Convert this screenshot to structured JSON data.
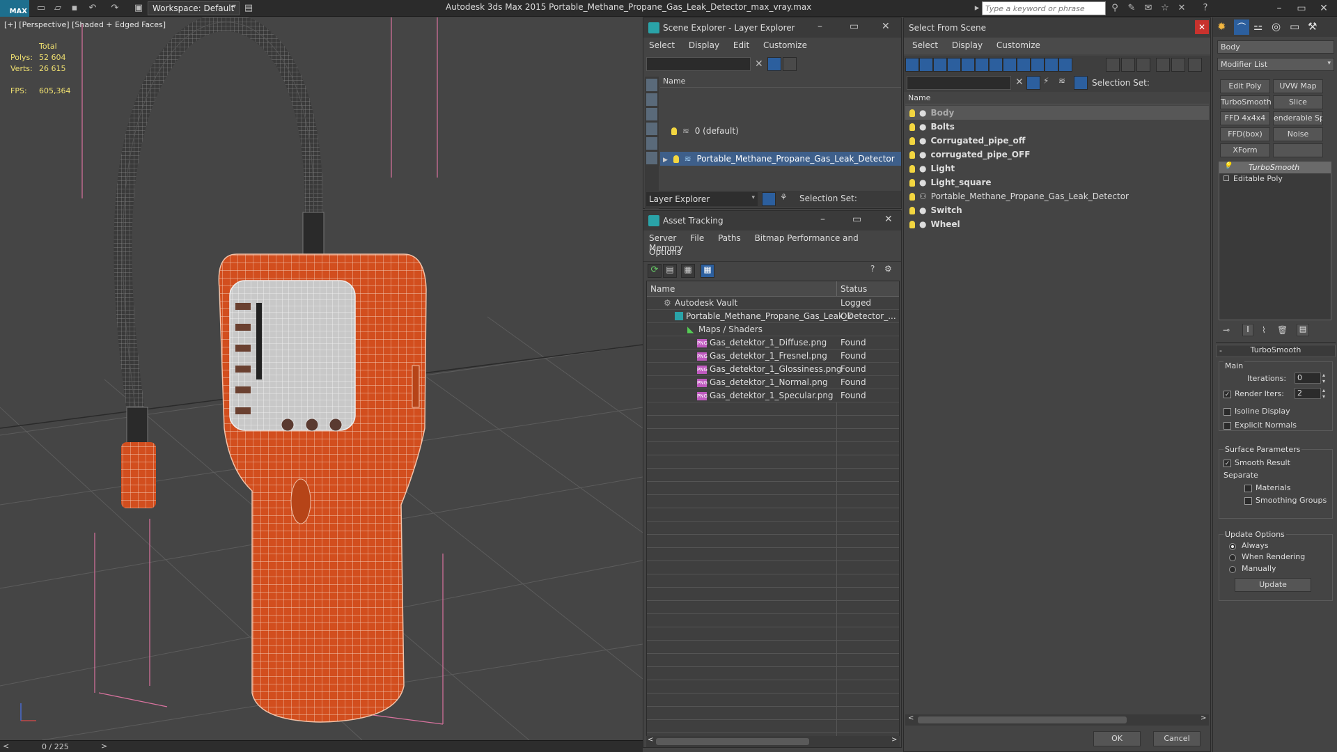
{
  "app": {
    "logo": "MAX",
    "workspace": "Workspace: Default",
    "title": "Autodesk 3ds Max  2015     Portable_Methane_Propane_Gas_Leak_Detector_max_vray.max",
    "search_placeholder": "Type a keyword or phrase"
  },
  "viewport": {
    "label": "[+] [Perspective] [Shaded + Edged Faces]",
    "stats": {
      "total_label": "Total",
      "polys_label": "Polys:",
      "polys": "52 604",
      "verts_label": "Verts:",
      "verts": "26 615",
      "fps_label": "FPS:",
      "fps": "605,364"
    },
    "timeline": "0 / 225"
  },
  "scene_explorer": {
    "title": "Scene Explorer - Layer Explorer",
    "menu": [
      "Select",
      "Display",
      "Edit",
      "Customize"
    ],
    "column": "Name",
    "layers": [
      "0 (default)",
      "Portable_Methane_Propane_Gas_Leak_Detector"
    ],
    "footer_mode": "Layer Explorer",
    "footer_selset": "Selection Set:"
  },
  "asset_tracking": {
    "title": "Asset Tracking",
    "menu": [
      "Server",
      "File",
      "Paths",
      "Bitmap Performance and Memory"
    ],
    "menu2": "Options",
    "col_name": "Name",
    "col_status": "Status",
    "rows": [
      {
        "name": "Autodesk Vault",
        "status": "Logged"
      },
      {
        "name": "Portable_Methane_Propane_Gas_Leak_Detector_...",
        "status": "Ok"
      },
      {
        "name": "Maps / Shaders",
        "status": ""
      },
      {
        "name": "Gas_detektor_1_Diffuse.png",
        "status": "Found"
      },
      {
        "name": "Gas_detektor_1_Fresnel.png",
        "status": "Found"
      },
      {
        "name": "Gas_detektor_1_Glossiness.png",
        "status": "Found"
      },
      {
        "name": "Gas_detektor_1_Normal.png",
        "status": "Found"
      },
      {
        "name": "Gas_detektor_1_Specular.png",
        "status": "Found"
      }
    ]
  },
  "select_from_scene": {
    "title": "Select From Scene",
    "menu": [
      "Select",
      "Display",
      "Customize"
    ],
    "selset": "Selection Set:",
    "column": "Name",
    "objects": [
      "Body",
      "Bolts",
      "Corrugated_pipe_off",
      "corrugated_pipe_OFF",
      "Light",
      "Light_square",
      "Portable_Methane_Propane_Gas_Leak_Detector",
      "Switch",
      "Wheel"
    ],
    "ok": "OK",
    "cancel": "Cancel"
  },
  "modifier_panel": {
    "object_name": "Body",
    "modifier_list": "Modifier List",
    "buttons": [
      "Edit Poly",
      "UVW Map",
      "TurboSmooth",
      "Slice",
      "FFD 4x4x4",
      "enderable Spli",
      "FFD(box)",
      "Noise",
      "XForm"
    ],
    "stack": [
      "TurboSmooth",
      "Editable Poly"
    ],
    "rollout_title": "TurboSmooth",
    "main_label": "Main",
    "iterations_label": "Iterations:",
    "iterations": "0",
    "render_iters_label": "Render Iters:",
    "render_iters": "2",
    "isoline": "Isoline Display",
    "explicit": "Explicit Normals",
    "surface_label": "Surface Parameters",
    "smooth_result": "Smooth Result",
    "separate_label": "Separate",
    "materials": "Materials",
    "smoothing_groups": "Smoothing Groups",
    "update_label": "Update Options",
    "always": "Always",
    "when_rendering": "When Rendering",
    "manually": "Manually",
    "update_btn": "Update"
  }
}
